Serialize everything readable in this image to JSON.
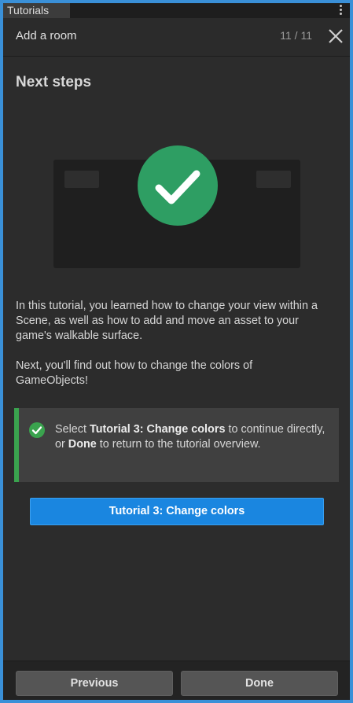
{
  "tab": {
    "label": "Tutorials"
  },
  "header": {
    "title": "Add a room",
    "progress": "11 / 11"
  },
  "content": {
    "heading": "Next steps",
    "paragraph1": "In this tutorial, you learned how to change your view within a Scene, as well as how to add and move an asset to your game's walkable surface.",
    "paragraph2": "Next, you'll find out how to change the colors of GameObjects!",
    "callout": {
      "text_before": "Select ",
      "bold1": "Tutorial 3: Change colors",
      "text_middle": " to continue directly, or ",
      "bold2": "Done",
      "text_after": " to return to the tutorial overview."
    },
    "primary_button": "Tutorial 3: Change colors"
  },
  "footer": {
    "previous_label": "Previous",
    "done_label": "Done"
  },
  "icons": {
    "menu": "kebab-menu-icon",
    "close": "close-icon",
    "success": "checkmark-circle-icon",
    "callout": "check-circle-icon"
  },
  "colors": {
    "accent_blue": "#1a86e0",
    "success_green": "#2e9e63",
    "callout_bar": "#3aa34e"
  }
}
